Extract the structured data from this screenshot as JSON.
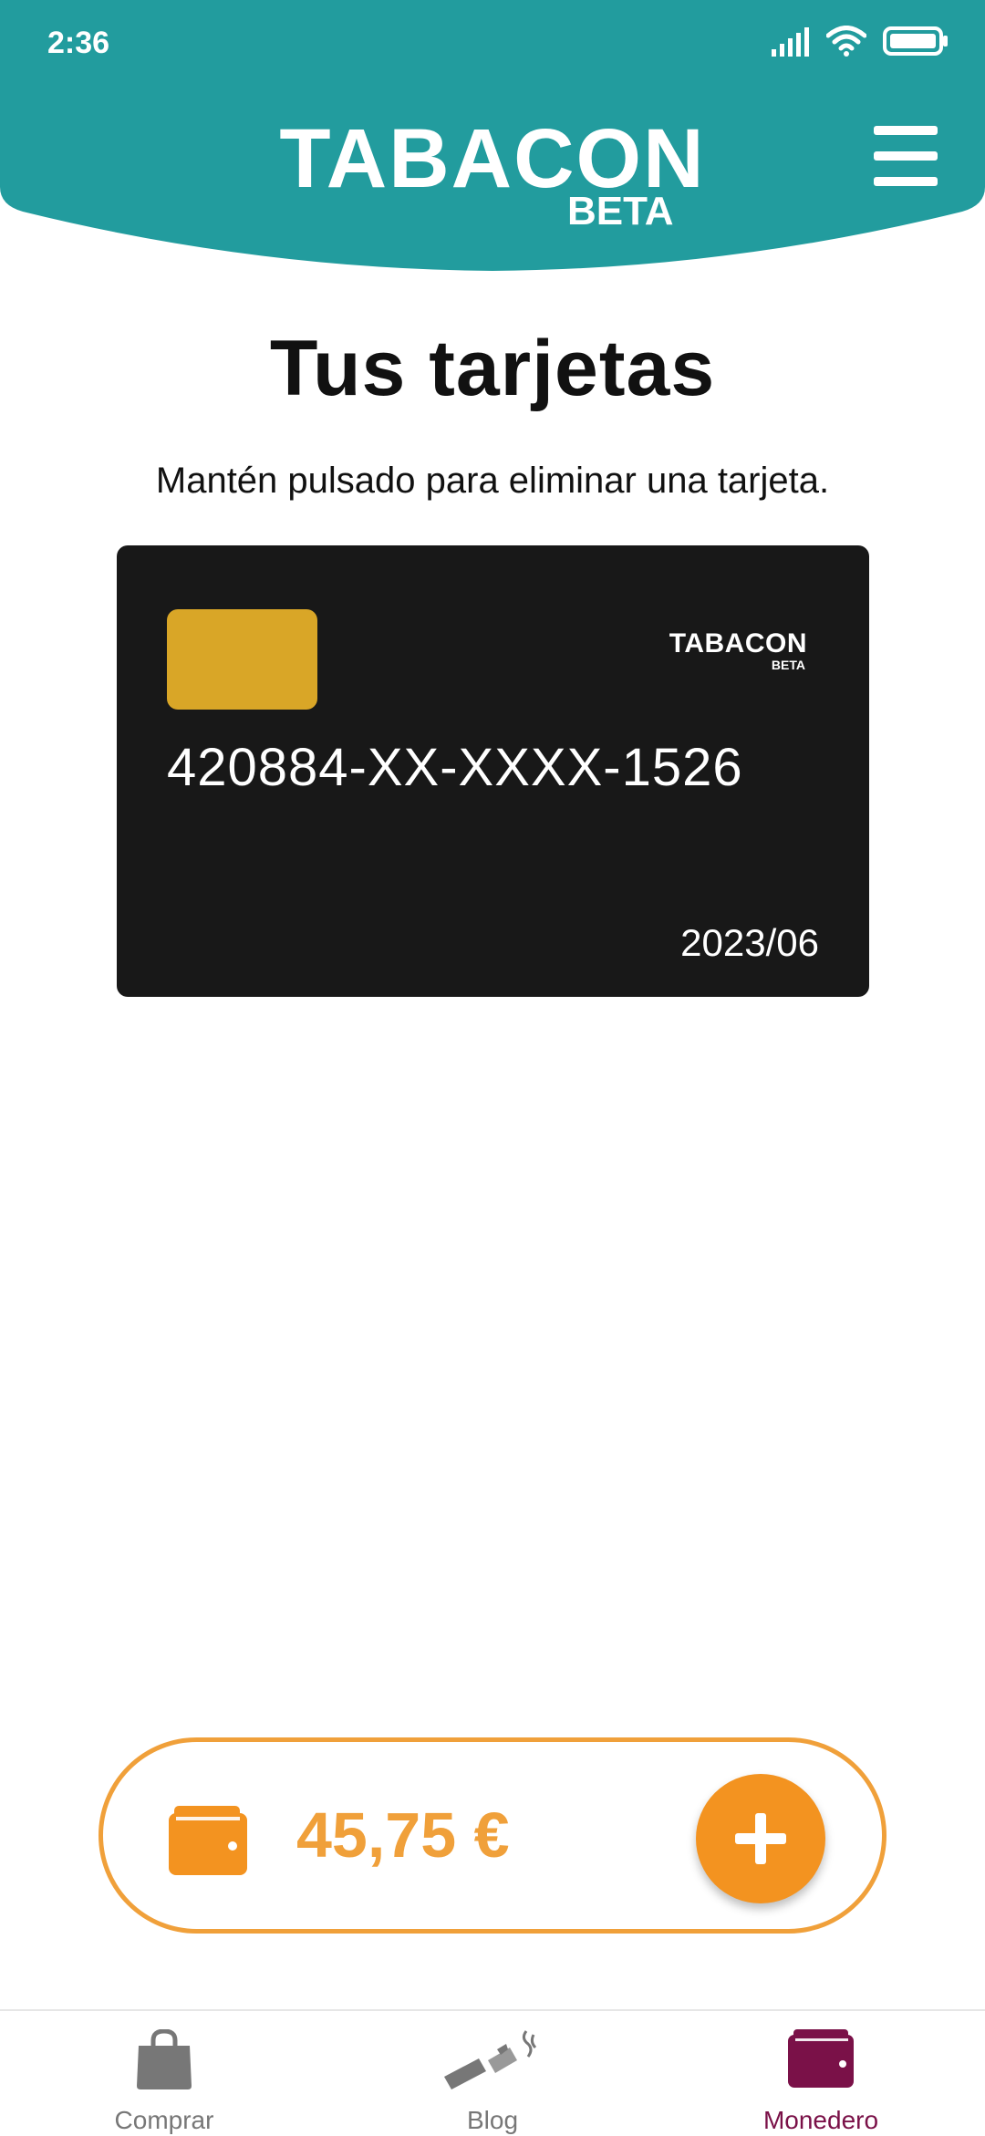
{
  "status_bar": {
    "time": "2:36"
  },
  "header": {
    "logo_text": "TABACON",
    "logo_sub": "BETA",
    "menu_icon": "hamburger-menu-icon",
    "color": "#229C9E"
  },
  "page": {
    "title": "Tus tarjetas",
    "hint": "Mantén pulsado para eliminar una tarjeta."
  },
  "card": {
    "number": "420884-XX-XXXX-1526",
    "expiry": "2023/06",
    "logo_text": "TABACON",
    "logo_sub": "BETA",
    "chip_color": "#D9A627",
    "background": "#181818"
  },
  "wallet": {
    "balance": "45,75 €",
    "icon": "wallet-icon",
    "add_icon": "plus-icon",
    "accent": "#F39320"
  },
  "bottom_nav": {
    "items": [
      {
        "label": "Comprar",
        "icon": "shopping-bag-icon",
        "active": false
      },
      {
        "label": "Blog",
        "icon": "broken-cigarette-icon",
        "active": false
      },
      {
        "label": "Monedero",
        "icon": "wallet-icon",
        "active": true
      }
    ],
    "active_color": "#7A1148"
  }
}
